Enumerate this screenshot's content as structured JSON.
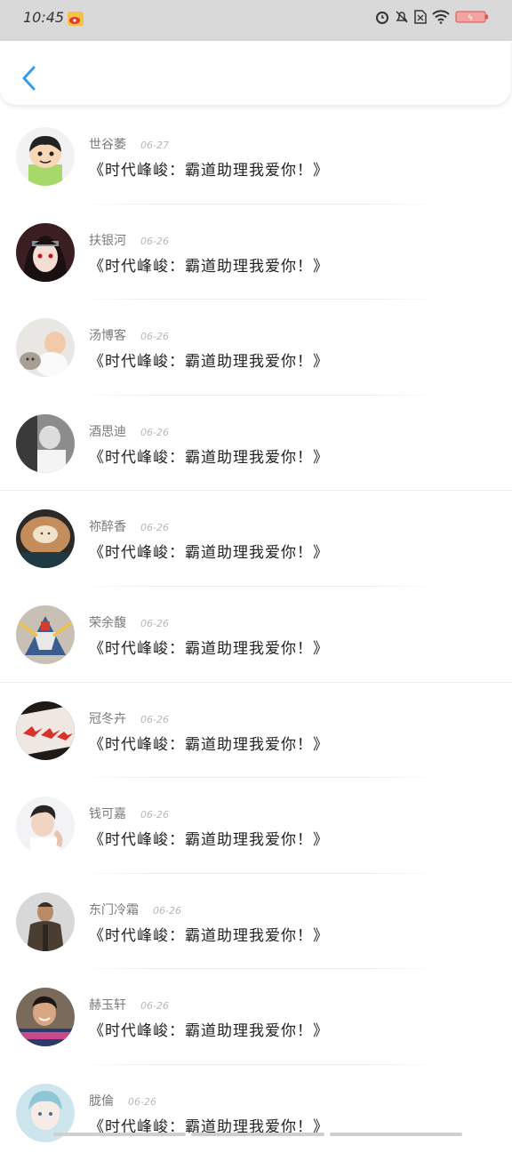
{
  "status_bar": {
    "time": "10:45",
    "app_icon": "weibo-icon",
    "icons": [
      "alarm-icon",
      "mute-icon",
      "no-sim-icon",
      "wifi-icon",
      "battery-low-icon"
    ],
    "battery_color": "#e74c3c"
  },
  "header": {
    "back_icon": "chevron-left-icon",
    "accent_color": "#3a9be8"
  },
  "comments": [
    {
      "name": "世谷萎",
      "date": "06-27",
      "message": "《时代峰峻：霸道助理我爱你！》",
      "avatar": "cartoon-boy-avatar"
    },
    {
      "name": "扶银河",
      "date": "06-26",
      "message": "《时代峰峻：霸道助理我爱你！》",
      "avatar": "anime-ninja-avatar"
    },
    {
      "name": "汤博客",
      "date": "06-26",
      "message": "《时代峰峻：霸道助理我爱你！》",
      "avatar": "baby-cat-avatar"
    },
    {
      "name": "酒思迪",
      "date": "06-26",
      "message": "《时代峰峻：霸道助理我爱你！》",
      "avatar": "bw-boy-avatar"
    },
    {
      "name": "祢醉香",
      "date": "06-26",
      "message": "《时代峰峻：霸道助理我爱你！》",
      "avatar": "latte-art-avatar"
    },
    {
      "name": "荣余馥",
      "date": "06-26",
      "message": "《时代峰峻：霸道助理我爱你！》",
      "avatar": "robot-avatar"
    },
    {
      "name": "冠冬卉",
      "date": "06-26",
      "message": "《时代峰峻：霸道助理我爱你！》",
      "avatar": "paper-cranes-avatar"
    },
    {
      "name": "钱可嘉",
      "date": "06-26",
      "message": "《时代峰峻：霸道助理我爱你！》",
      "avatar": "young-man-avatar"
    },
    {
      "name": "东门冷霜",
      "date": "06-26",
      "message": "《时代峰峻：霸道助理我爱你！》",
      "avatar": "soldier-avatar"
    },
    {
      "name": "赫玉轩",
      "date": "06-26",
      "message": "《时代峰峻：霸道助理我爱你！》",
      "avatar": "smiling-man-avatar"
    },
    {
      "name": "胧倫",
      "date": "06-26",
      "message": "《时代峰峻：霸道助理我爱你！》",
      "avatar": "anime-girl-avatar"
    }
  ]
}
